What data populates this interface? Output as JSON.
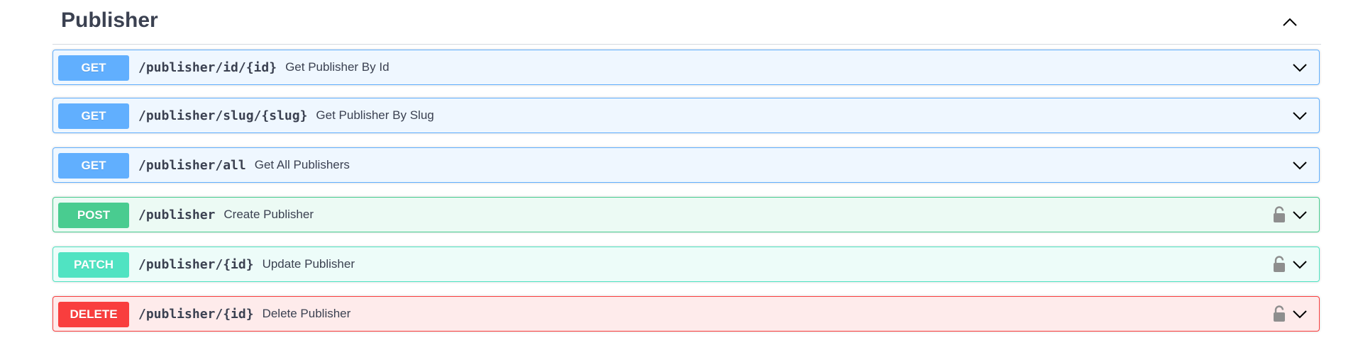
{
  "section": {
    "title": "Publisher",
    "collapse_icon": "chevron-up-icon"
  },
  "operations": [
    {
      "method": "GET",
      "path": "/publisher/id/{id}",
      "summary": "Get Publisher By Id",
      "locked": false,
      "color": "#61affe"
    },
    {
      "method": "GET",
      "path": "/publisher/slug/{slug}",
      "summary": "Get Publisher By Slug",
      "locked": false,
      "color": "#61affe"
    },
    {
      "method": "GET",
      "path": "/publisher/all",
      "summary": "Get All Publishers",
      "locked": false,
      "color": "#61affe"
    },
    {
      "method": "POST",
      "path": "/publisher",
      "summary": "Create Publisher",
      "locked": true,
      "color": "#49cc90"
    },
    {
      "method": "PATCH",
      "path": "/publisher/{id}",
      "summary": "Update Publisher",
      "locked": true,
      "color": "#50e3c2"
    },
    {
      "method": "DELETE",
      "path": "/publisher/{id}",
      "summary": "Delete Publisher",
      "locked": true,
      "color": "#f93e3e"
    }
  ]
}
